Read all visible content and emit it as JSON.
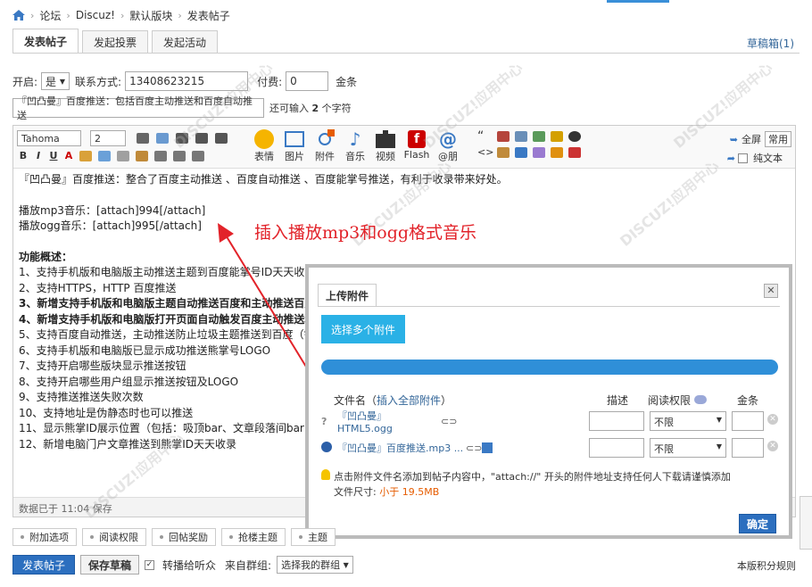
{
  "breadcrumb": {
    "items": [
      "论坛",
      "Discuz!",
      "默认版块",
      "发表帖子"
    ]
  },
  "tabs": [
    {
      "label": "发表帖子"
    },
    {
      "label": "发起投票"
    },
    {
      "label": "发起活动"
    }
  ],
  "draft_link": "草稿箱(1)",
  "form": {
    "open_label": "开启:",
    "open_value": "是",
    "contact_label": "联系方式:",
    "contact_value": "13408623215",
    "fee_label": "付费:",
    "fee_value": "0",
    "fee_unit": "金条",
    "title_value": "『凹凸曼』百度推送：包括百度主动推送和百度自动推送",
    "remaining_prefix": "还可输入",
    "remaining_count": "2",
    "remaining_suffix": "个字符"
  },
  "toolbar": {
    "font": "Tahoma",
    "size": "2",
    "labels": [
      "表情",
      "图片",
      "附件",
      "音乐",
      "视频",
      "Flash",
      "@朋"
    ],
    "fullscreen": "全屏",
    "common": "常用",
    "plain_text": "纯文本"
  },
  "content": {
    "intro": "『凹凸曼』百度推送：整合了百度主动推送 、百度自动推送 、百度能掌号推送，有利于收录带来好处。",
    "mp3_line": "播放mp3音乐：[attach]994[/attach]",
    "ogg_line": "播放ogg音乐：[attach]995[/attach]",
    "features_title": "功能概述：",
    "features": [
      "1、支持手机版和电脑版主动推送主题到百度能掌号ID天天收录AP",
      "2、支持HTTPS，HTTP 百度推送",
      "3、新增支持手机版和电脑版主题自动推送百度和主动推送百度",
      "4、新增支持手机版和电脑版打开页面自动触发百度主动推送和",
      "5、支持百度自动推送，主动推送防止垃圾主题推送到百度（需",
      "6、支持手机版和电脑版已显示成功推送熊掌号LOGO",
      "7、支持开启哪些版块显示推送按钮",
      "8、支持开启哪些用户组显示推送按钮及LOGO",
      "9、支持推送推送失败次数",
      "10、支持地址是伪静态时也可以推送",
      "11、显示熊掌ID展示位置（包括：吸顶bar、文章段落间bar（",
      "12、新增电脑门户文章推送到熊掌ID天天收录"
    ],
    "status": "数据已于 11:04 保存"
  },
  "annotation": "插入播放mp3和ogg格式音乐",
  "dialog": {
    "title": "上传附件",
    "upload_button": "选择多个附件",
    "col_filename": "文件名",
    "col_insert_all": "插入全部附件",
    "col_desc": "描述",
    "col_permission": "阅读权限",
    "col_price": "金条",
    "files": [
      {
        "name": "『凹凸曼』HTML5.ogg",
        "permission": "不限"
      },
      {
        "name": "『凹凸曼』百度推送.mp3 ...",
        "permission": "不限"
      }
    ],
    "tip": "点击附件文件名添加到帖子内容中，\"attach://\" 开头的附件地址支持任何人下载请谨慎添加",
    "size_label": "文件尺寸:",
    "size_value": "小于 19.5MB",
    "ok": "确定"
  },
  "bottom_tabs": [
    "附加选项",
    "阅读权限",
    "回帖奖励",
    "抢楼主题",
    "主题"
  ],
  "actions": {
    "publish": "发表帖子",
    "save_draft": "保存草稿",
    "broadcast": "转播给听众",
    "group_label": "来自群组:",
    "group_value": "选择我的群组",
    "rules": "本版积分规则"
  }
}
